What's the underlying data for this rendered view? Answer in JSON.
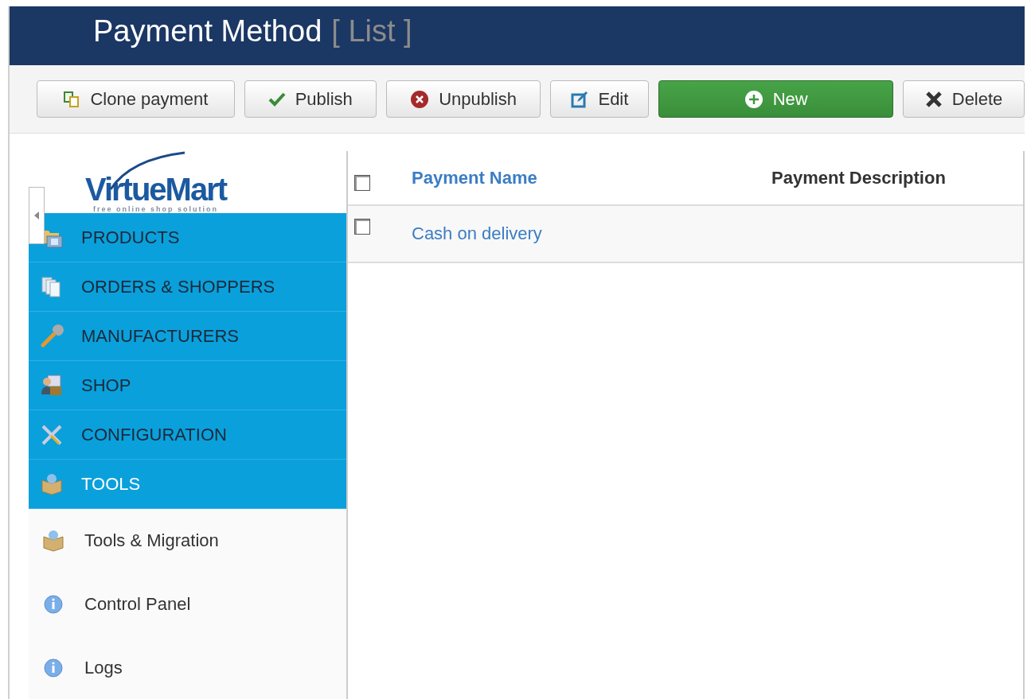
{
  "header": {
    "title": "Payment Method",
    "subtitle": "[ List ]"
  },
  "toolbar": [
    {
      "label": "Clone payment",
      "kind": "clone"
    },
    {
      "label": "Publish",
      "kind": "publish"
    },
    {
      "label": "Unpublish",
      "kind": "unpublish"
    },
    {
      "label": "Edit",
      "kind": "edit"
    },
    {
      "label": "New",
      "kind": "new"
    },
    {
      "label": "Delete",
      "kind": "delete"
    }
  ],
  "sidebar": {
    "logo": {
      "name": "VirtueMart",
      "tagline": "free online shop solution"
    },
    "menu": [
      {
        "label": "PRODUCTS",
        "kind": "products",
        "selected": false
      },
      {
        "label": "ORDERS & SHOPPERS",
        "kind": "orders",
        "selected": false
      },
      {
        "label": "MANUFACTURERS",
        "kind": "manufacturers",
        "selected": false
      },
      {
        "label": "SHOP",
        "kind": "shop",
        "selected": false
      },
      {
        "label": "CONFIGURATION",
        "kind": "configuration",
        "selected": false
      },
      {
        "label": "TOOLS",
        "kind": "tools",
        "selected": true,
        "children": [
          {
            "label": "Tools & Migration",
            "kind": "tools"
          },
          {
            "label": "Control Panel",
            "kind": "info"
          },
          {
            "label": "Logs",
            "kind": "info"
          }
        ]
      }
    ]
  },
  "table": {
    "select_all": {
      "checked": false
    },
    "columns": [
      "Payment Name",
      "Payment Description"
    ],
    "rows": [
      {
        "checked": false,
        "name": "Cash on delivery",
        "description": ""
      }
    ]
  }
}
